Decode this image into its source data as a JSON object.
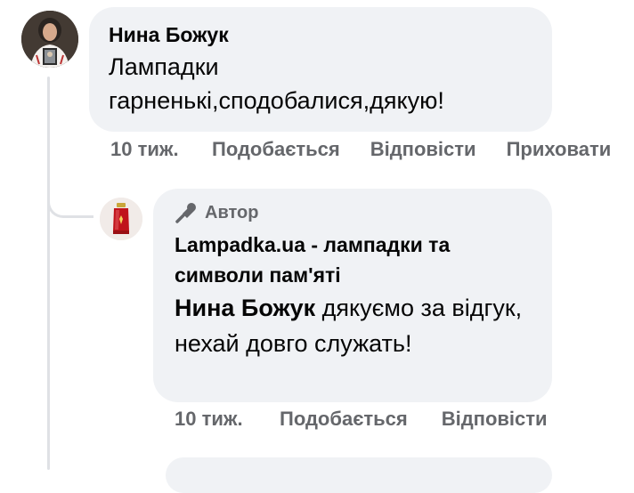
{
  "comments": [
    {
      "author": "Нина Божук",
      "text": "Лампадки гарненькі,сподобалися,дякую!",
      "time": "10 тиж.",
      "actions": {
        "like": "Подобається",
        "reply": "Відповісти",
        "hide": "Приховати"
      }
    }
  ],
  "reply": {
    "badge": "Автор",
    "author": "Lampadka.ua - лампадки та символи пам'яті",
    "mention": "Нина Божук",
    "text": " дякуємо за відгук, нехай довго служать!",
    "time": "10 тиж.",
    "actions": {
      "like": "Подобається",
      "reply": "Відповісти"
    }
  },
  "colors": {
    "bubble": "#f0f2f5",
    "secondary_text": "#65676b",
    "thread_line": "#dfe1e5",
    "lamp_red": "#c0141b"
  },
  "icons": {
    "author_badge": "microphone-icon"
  }
}
